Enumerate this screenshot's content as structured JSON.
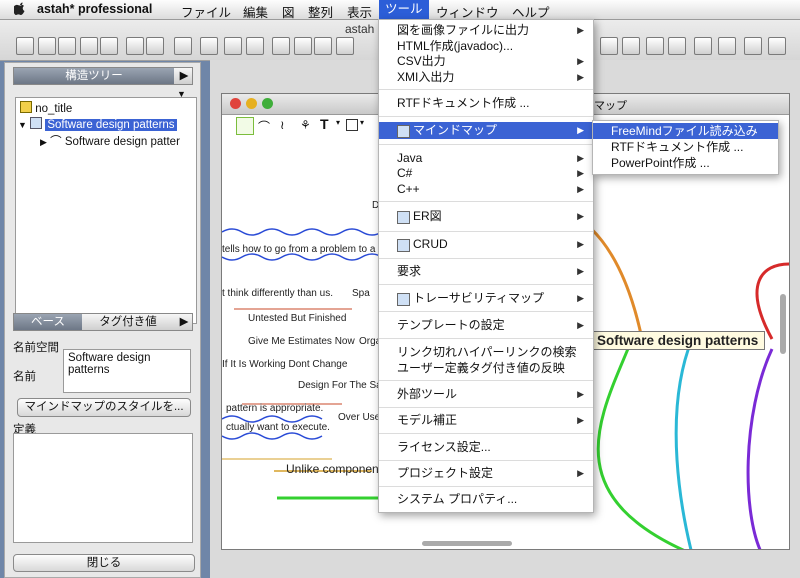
{
  "menubar": {
    "apple": "",
    "app": "astah* professional",
    "items": [
      "ファイル",
      "編集",
      "図",
      "整列",
      "表示",
      "ツール",
      "ウィンドウ",
      "ヘルプ"
    ]
  },
  "toolbar": {
    "window_title": "astah"
  },
  "left_panel": {
    "tree_tab": "構造ツリー",
    "tree": {
      "root": "no_title",
      "child": "Software design patterns",
      "grandchild": "Software design patter"
    },
    "props_tabs": [
      "ベース",
      "タグ付き値"
    ],
    "namespace_label": "名前空間",
    "name_label": "名前",
    "name_value": "Software design patterns",
    "style_button": "マインドマップのスタイルを...",
    "definition_label": "定義",
    "close_button": "閉じる"
  },
  "diagram": {
    "title_fragment": "マップ",
    "central_topic": "Software design patterns",
    "nodes": [
      "tells how to go from a problem to a ba",
      "t think differently than us.",
      "Spa",
      "Untested But Finished",
      "Give Me Estimates Now",
      "Orga",
      "If It Is Working Dont Change",
      "Design For The Sake",
      "pattern is appropriate.",
      "Over Use",
      "ctually want to execute.",
      "Unlike componen",
      "De"
    ]
  },
  "tools_menu": {
    "items": [
      {
        "label": "図を画像ファイルに出力",
        "submenu": true
      },
      {
        "label": "HTML作成(javadoc)...",
        "submenu": false
      },
      {
        "label": "CSV出力",
        "submenu": true
      },
      {
        "label": "XMI入出力",
        "submenu": true
      },
      {
        "label": "RTFドキュメント作成 ...",
        "submenu": false
      },
      {
        "label": "マインドマップ",
        "submenu": true,
        "highlighted": true
      },
      {
        "label": "Java",
        "submenu": true
      },
      {
        "label": "C#",
        "submenu": true
      },
      {
        "label": "C++",
        "submenu": true
      },
      {
        "label": "ER図",
        "submenu": true
      },
      {
        "label": "CRUD",
        "submenu": true
      },
      {
        "label": "要求",
        "submenu": true
      },
      {
        "label": "トレーサビリティマップ",
        "submenu": true
      },
      {
        "label": "テンプレートの設定",
        "submenu": true
      },
      {
        "label": "リンク切れハイパーリンクの検索",
        "submenu": false
      },
      {
        "label": "ユーザー定義タグ付き値の反映",
        "submenu": false
      },
      {
        "label": "外部ツール",
        "submenu": true
      },
      {
        "label": "モデル補正",
        "submenu": true
      },
      {
        "label": "ライセンス設定...",
        "submenu": false
      },
      {
        "label": "プロジェクト設定",
        "submenu": true
      },
      {
        "label": "システム プロパティ...",
        "submenu": false
      }
    ]
  },
  "mindmap_submenu": {
    "items": [
      "FreeMindファイル読み込み",
      "RTFドキュメント作成 ...",
      "PowerPoint作成 ..."
    ]
  },
  "colors": {
    "highlight": "#3b63d4",
    "menubar_active": "#2c5ed8"
  }
}
